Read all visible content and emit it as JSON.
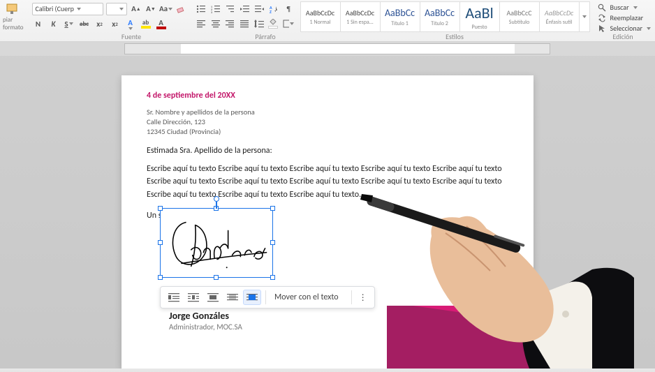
{
  "ribbon": {
    "font_family": "Calibri (Cuerp",
    "btnA": "A",
    "btnAa": "Aa",
    "boldLabel": "N",
    "italicLabel": "K",
    "underlineLabel": "S",
    "strikeLabel": "abc",
    "clipboard_label": "piar formato",
    "styles": [
      {
        "sample": "AaBbCcDc",
        "lbl": "1 Normal"
      },
      {
        "sample": "AaBbCcDc",
        "lbl": "1 Sin espa..."
      },
      {
        "sample": "AaBbCc",
        "lbl": "Título 1"
      },
      {
        "sample": "AaBbCc",
        "lbl": "Título 2"
      },
      {
        "sample": "AaBl",
        "lbl": "Puesto"
      },
      {
        "sample": "AaBbCcC",
        "lbl": "Subtítulo"
      },
      {
        "sample": "AaBbCcDc",
        "lbl": "Énfasis sutil"
      }
    ],
    "groups": {
      "font": "Fuente",
      "paragraph": "Párrafo",
      "styles": "Estilos",
      "editing": "Edición"
    },
    "editing": {
      "find": "Buscar",
      "replace": "Reemplazar",
      "select": "Seleccionar"
    }
  },
  "document": {
    "date": "4 de septiembre del 20XX",
    "address_line1": "Sr. Nombre y apellidos de la persona",
    "address_line2": "Calle Dirección, 123",
    "address_line3": "12345 Ciudad (Provincia)",
    "salutation": "Estimada Sra. Apellido de la persona:",
    "body": "Escribe aquí tu texto Escribe aquí tu texto Escribe aquí tu texto Escribe aquí tu texto Escribe aquí tu texto Escribe aquí tu texto Escribe aquí tu texto Escribe aquí tu texto Escribe aquí tu texto Escribe aquí tu texto Escribe aquí tu texto Escribe aquí tu texto Escribe aquí tu texto.",
    "closing": "Un saludo,4",
    "signer_name": "Jorge Gonzáles",
    "signer_title": "Administrador, MOC.SA"
  },
  "context_toolbar": {
    "move_text": "Mover con el texto",
    "more": "⋮"
  },
  "colors": {
    "accent": "#c3176a",
    "selection": "#1a73e8",
    "corner_main": "#d81b76",
    "corner_dark": "#9b1f5f",
    "highlight_yellow": "#ffe600",
    "font_color": "#c00000"
  }
}
